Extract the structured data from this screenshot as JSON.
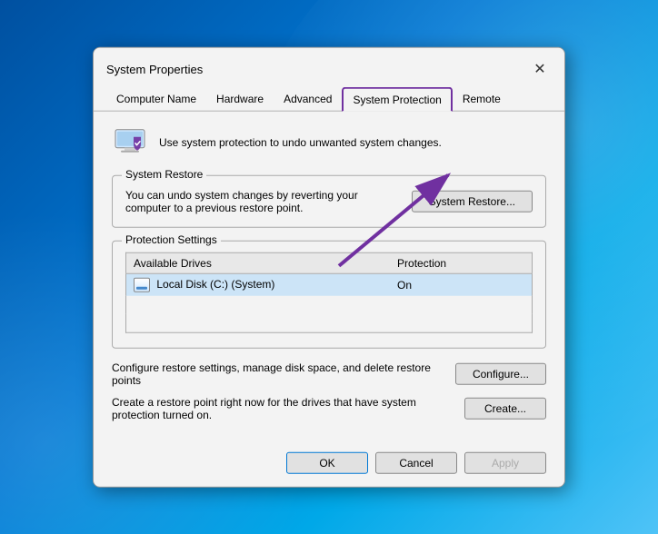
{
  "dialog": {
    "title": "System Properties",
    "close_label": "✕"
  },
  "tabs": [
    {
      "id": "computer-name",
      "label": "Computer Name",
      "active": false
    },
    {
      "id": "hardware",
      "label": "Hardware",
      "active": false
    },
    {
      "id": "advanced",
      "label": "Advanced",
      "active": false
    },
    {
      "id": "system-protection",
      "label": "System Protection",
      "active": true
    },
    {
      "id": "remote",
      "label": "Remote",
      "active": false
    }
  ],
  "header": {
    "description": "Use system protection to undo unwanted system changes."
  },
  "system_restore": {
    "section_label": "System Restore",
    "description": "You can undo system changes by reverting your computer to a previous restore point.",
    "button_label": "System Restore..."
  },
  "protection_settings": {
    "section_label": "Protection Settings",
    "columns": [
      "Available Drives",
      "Protection"
    ],
    "rows": [
      {
        "drive": "Local Disk (C:) (System)",
        "protection": "On",
        "selected": true
      }
    ]
  },
  "actions": [
    {
      "description": "Configure restore settings, manage disk space, and delete restore points",
      "button_label": "Configure..."
    },
    {
      "description": "Create a restore point right now for the drives that have system protection turned on.",
      "button_label": "Create..."
    }
  ],
  "footer_buttons": [
    {
      "id": "ok",
      "label": "OK",
      "default": true
    },
    {
      "id": "cancel",
      "label": "Cancel",
      "default": false
    },
    {
      "id": "apply",
      "label": "Apply",
      "default": false,
      "disabled": true
    }
  ]
}
